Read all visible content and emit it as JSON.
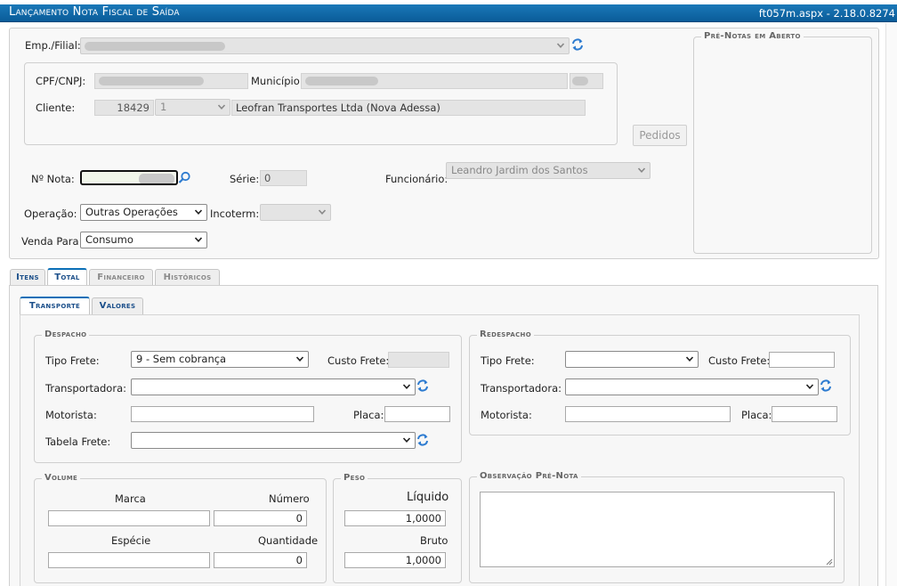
{
  "window": {
    "title": "Lançamento Nota Fiscal de Saída",
    "version": "ft057m.aspx - 2.18.0.8274"
  },
  "header": {
    "emp_filial_label": "Emp./Filial:",
    "cpf_cnpj_label": "CPF/CNPJ:",
    "municipio_label": "Município:",
    "cliente_label": "Cliente:",
    "cliente_codigo": "18429",
    "cliente_seq": "1",
    "cliente_nome": "Leofran Transportes Ltda (Nova Adessa)",
    "pedidos_button": "Pedidos",
    "pre_notas_legend": "Pré-Notas em Aberto",
    "nota_label": "Nº Nota:",
    "serie_label": "Série:",
    "serie_value": "0",
    "funcionario_label": "Funcionário:",
    "funcionario_value": "Leandro Jardim dos Santos",
    "operacao_label": "Operação:",
    "operacao_value": "Outras Operações",
    "incoterm_label": "Incoterm:",
    "incoterm_value": "",
    "venda_para_label": "Venda Para:",
    "venda_para_value": "Consumo"
  },
  "tabs": [
    "Itens",
    "Total",
    "Financeiro",
    "Históricos"
  ],
  "subtabs": [
    "Transporte",
    "Valores"
  ],
  "despacho": {
    "legend": "Despacho",
    "tipo_frete_label": "Tipo Frete:",
    "tipo_frete_value": "9 - Sem cobrança",
    "custo_frete_label": "Custo Frete:",
    "transportadora_label": "Transportadora:",
    "motorista_label": "Motorista:",
    "placa_label": "Placa:",
    "tabela_frete_label": "Tabela Frete:"
  },
  "redespacho": {
    "legend": "Redespacho",
    "tipo_frete_label": "Tipo Frete:",
    "custo_frete_label": "Custo Frete:",
    "transportadora_label": "Transportadora:",
    "motorista_label": "Motorista:",
    "placa_label": "Placa:"
  },
  "volume": {
    "legend": "Volume",
    "marca_label": "Marca",
    "numero_label": "Número",
    "numero_value": "0",
    "especie_label": "Espécie",
    "quantidade_label": "Quantidade",
    "quantidade_value": "0"
  },
  "peso": {
    "legend": "Peso",
    "liquido_label": "Líquido",
    "liquido_value": "1,0000",
    "bruto_label": "Bruto",
    "bruto_value": "1,0000"
  },
  "observacao": {
    "legend": "Observação Pré-Nota"
  },
  "colors": {
    "title_bar": "#0a6fb7",
    "tab_active_border": "#0a6fb7",
    "refresh_icon": "#2d7bd0"
  }
}
